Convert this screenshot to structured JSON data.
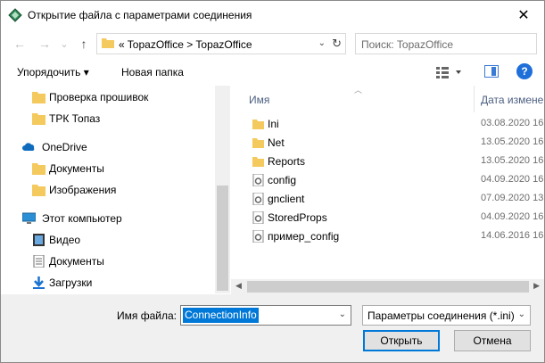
{
  "window": {
    "title": "Открытие файла с параметрами соединения",
    "close_glyph": "✕"
  },
  "nav": {
    "back_glyph": "←",
    "forward_glyph": "→",
    "recent_glyph": "⌄",
    "up_glyph": "↑",
    "address": "«  TopazOffice  >  TopazOffice",
    "address_dd_glyph": "⌄",
    "refresh_glyph": "↻",
    "search_placeholder": "Поиск: TopazOffice"
  },
  "toolbar": {
    "organize_label": "Упорядочить ▾",
    "new_folder_label": "Новая папка",
    "help_glyph": "?"
  },
  "left_pane": {
    "items": [
      {
        "label": "Проверка прошивок",
        "icon": "folder-icon"
      },
      {
        "label": "ТРК Топаз",
        "icon": "folder-icon"
      },
      {
        "label": "OneDrive",
        "icon": "cloud-icon"
      },
      {
        "label": "Документы",
        "icon": "folder-icon"
      },
      {
        "label": "Изображения",
        "icon": "folder-icon"
      },
      {
        "label": "Этот компьютер",
        "icon": "computer-icon"
      },
      {
        "label": "Видео",
        "icon": "video-icon"
      },
      {
        "label": "Документы",
        "icon": "document-icon"
      },
      {
        "label": "Загрузки",
        "icon": "download-icon"
      }
    ]
  },
  "file_list": {
    "col_name": "Имя",
    "col_date": "Дата изменен",
    "files": [
      {
        "name": "Ini",
        "date": "03.08.2020 16:",
        "icon": "folder-icon"
      },
      {
        "name": "Net",
        "date": "13.05.2020 16:",
        "icon": "folder-icon"
      },
      {
        "name": "Reports",
        "date": "13.05.2020 16:",
        "icon": "folder-icon"
      },
      {
        "name": "config",
        "date": "04.09.2020 16:",
        "icon": "settings-file-icon"
      },
      {
        "name": "gnclient",
        "date": "07.09.2020 13:",
        "icon": "settings-file-icon"
      },
      {
        "name": "StoredProps",
        "date": "04.09.2020 16:",
        "icon": "settings-file-icon"
      },
      {
        "name": "пример_config",
        "date": "14.06.2016 16:",
        "icon": "settings-file-icon"
      }
    ]
  },
  "bottom": {
    "filename_label": "Имя файла:",
    "filename_value": "ConnectionInfo",
    "filetype_value": "Параметры соединения (*.ini)",
    "open_label": "Открыть",
    "cancel_label": "Отмена"
  },
  "colors": {
    "accent": "#0078d7",
    "folder": "#f4c95d",
    "header_text": "#4d6082"
  }
}
